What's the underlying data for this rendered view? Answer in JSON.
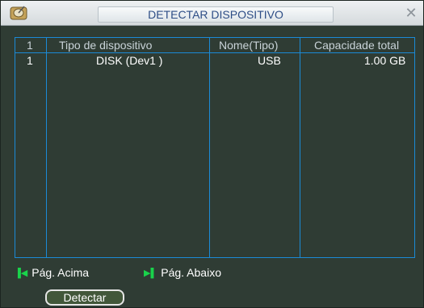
{
  "window": {
    "title": "DETECTAR DISPOSITIVO",
    "app_icon": "disk-icon",
    "close_icon": "close-icon"
  },
  "table": {
    "headers": [
      "1",
      "Tipo de dispositivo",
      "Nome(Tipo)",
      "Capacidade total"
    ],
    "rows": [
      [
        "1",
        "DISK (Dev1 )",
        "USB",
        "1.00 GB"
      ]
    ]
  },
  "footer": {
    "prev_page": "Pág. Acima",
    "next_page": "Pág. Abaixo",
    "prev_icon": "first-page-icon",
    "next_icon": "next-page-icon"
  },
  "actions": {
    "detect_label": "Detectar"
  },
  "colors": {
    "background": "#2f3c34",
    "grid_line": "#1b8ad6",
    "title_text": "#2d4d86",
    "nav_icon": "#19d34b"
  }
}
